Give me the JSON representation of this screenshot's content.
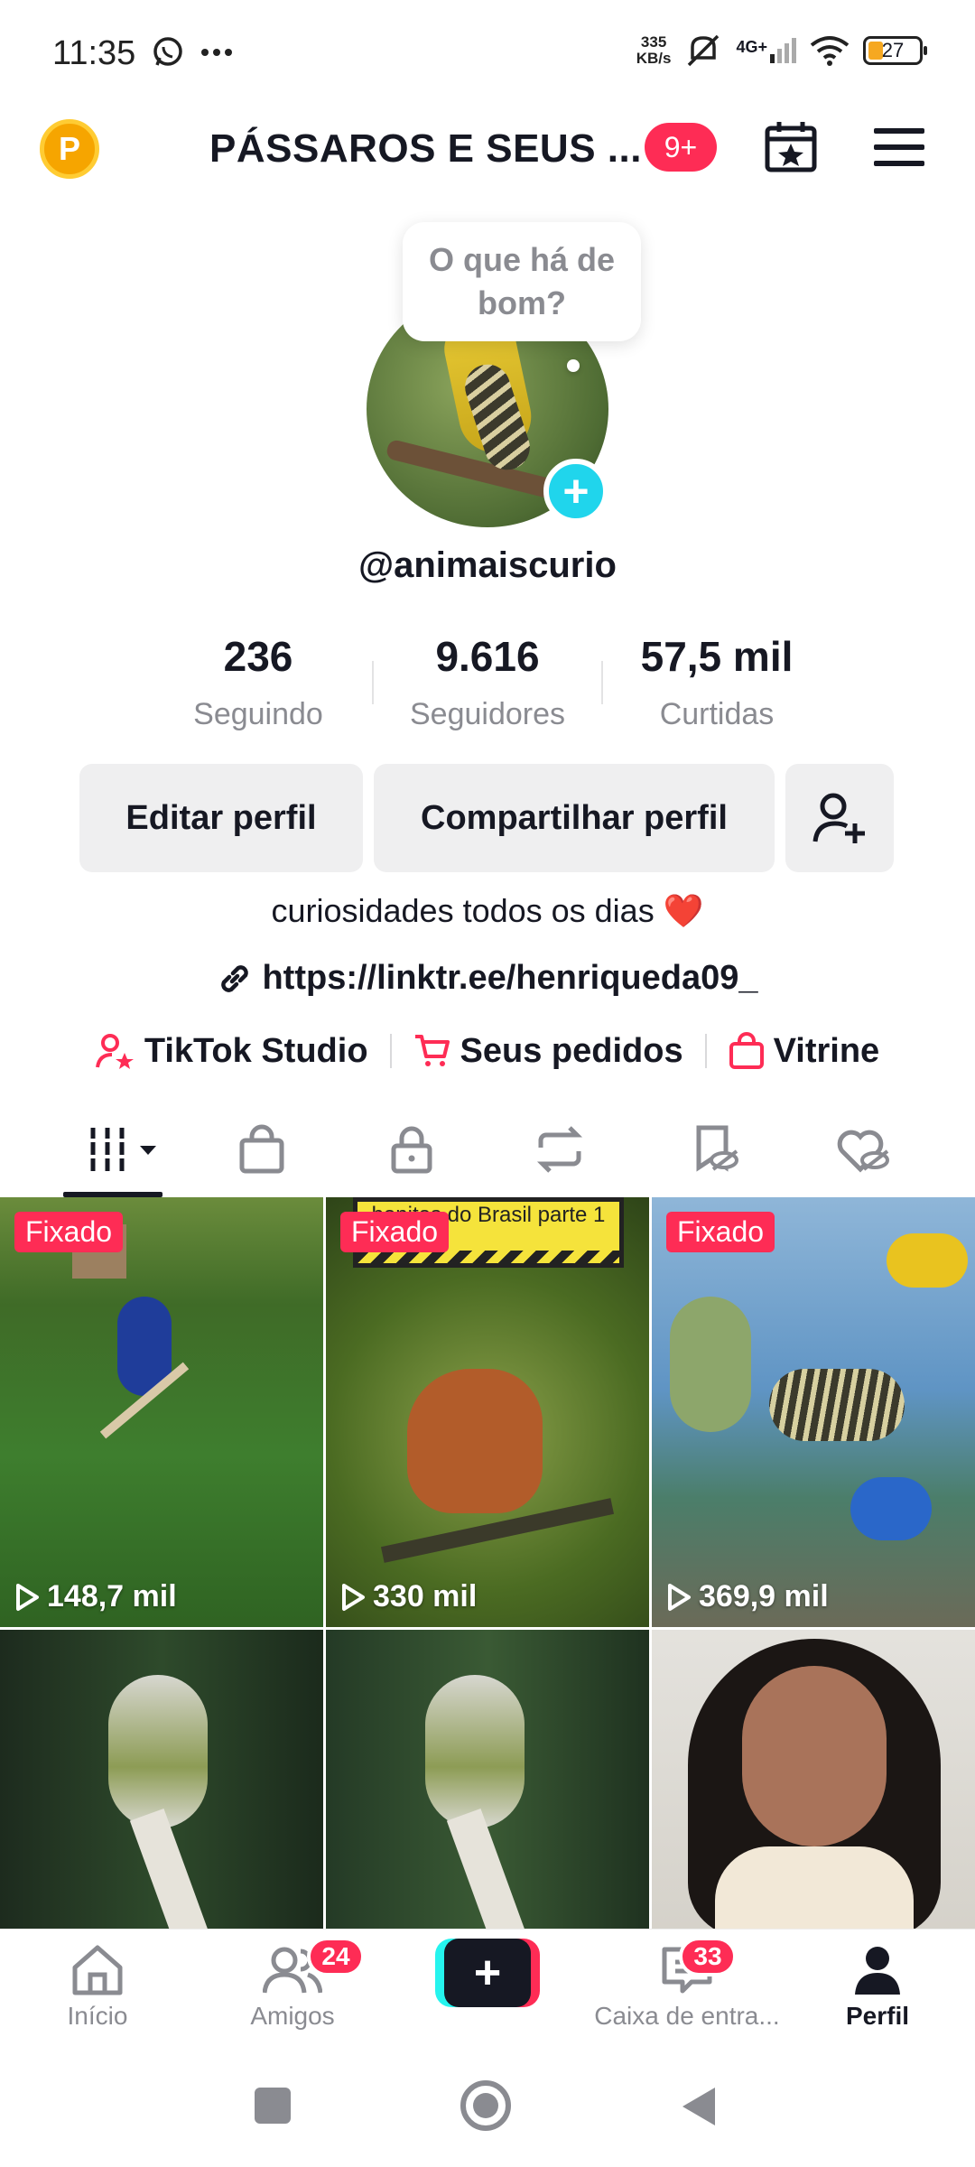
{
  "status_bar": {
    "time": "11:35",
    "speed_value": "335",
    "speed_unit": "KB/s",
    "network": "4G+",
    "battery": "27"
  },
  "header": {
    "title": "PÁSSAROS E SEUS ...",
    "badge": "9+"
  },
  "profile": {
    "bubble_text": "O que há de bom?",
    "username": "@animaiscurio",
    "stats": [
      {
        "value": "236",
        "label": "Seguindo"
      },
      {
        "value": "9.616",
        "label": "Seguidores"
      },
      {
        "value": "57,5 mil",
        "label": "Curtidas"
      }
    ],
    "buttons": {
      "edit": "Editar perfil",
      "share": "Compartilhar perfil"
    },
    "bio": "curiosidades todos os dias ❤️",
    "link": "https://linktr.ee/henriqueda09_",
    "quick_links": [
      "TikTok Studio",
      "Seus pedidos",
      "Vitrine"
    ]
  },
  "grid": {
    "pinned_label": "Fixado",
    "videos": [
      {
        "views": "148,7 mil",
        "pinned": true
      },
      {
        "views": "330 mil",
        "pinned": true,
        "overlay_text": "bonitos do Brasil parte 1"
      },
      {
        "views": "369,9 mil",
        "pinned": true
      },
      {
        "views": "",
        "pinned": false
      },
      {
        "views": "",
        "pinned": false
      },
      {
        "views": "",
        "pinned": false
      }
    ]
  },
  "bottom_nav": {
    "items": [
      {
        "label": "Início",
        "badge": ""
      },
      {
        "label": "Amigos",
        "badge": "24"
      },
      {
        "label": "",
        "badge": ""
      },
      {
        "label": "Caixa de entra...",
        "badge": "33"
      },
      {
        "label": "Perfil",
        "badge": ""
      }
    ]
  },
  "colors": {
    "accent": "#fe2c55",
    "cyan": "#20d5ec",
    "text": "#161823",
    "muted": "#8a8b91"
  }
}
